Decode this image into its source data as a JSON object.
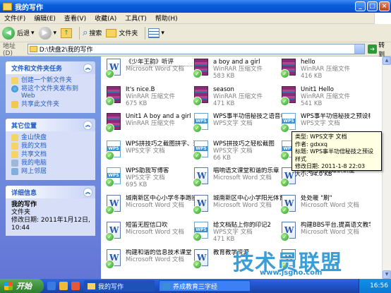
{
  "window": {
    "title": "我的写作"
  },
  "menu": [
    "文件(F)",
    "编辑(E)",
    "查看(V)",
    "收藏(A)",
    "工具(T)",
    "帮助(H)"
  ],
  "toolbar": {
    "back": "后退",
    "search": "搜索",
    "folders": "文件夹"
  },
  "address": {
    "label": "地址(D)",
    "value": "D:\\快盘2\\我的写作",
    "go": "转到"
  },
  "tasks": {
    "title": "文件和文件夹任务",
    "items": [
      "创建一个新文件夹",
      "将这个文件夹发布到 Web",
      "共享此文件夹"
    ]
  },
  "places": {
    "title": "其它位置",
    "items": [
      "金山快盘",
      "我的文档",
      "共享文档",
      "我的电脑",
      "网上邻居"
    ]
  },
  "details": {
    "title": "详细信息",
    "name": "我的写作",
    "type": "文件夹",
    "modified": "修改日期: 2011年1月12日, 10:44"
  },
  "files": [
    {
      "name": "《少年王韵》听评",
      "type": "Microsoft Word 文档",
      "size": "",
      "kind": "word"
    },
    {
      "name": "a boy and a girl",
      "type": "WinRAR 压缩文件",
      "size": "583 KB",
      "kind": "rar"
    },
    {
      "name": "hello",
      "type": "WinRAR 压缩文件",
      "size": "416 KB",
      "kind": "rar"
    },
    {
      "name": "It's nice.B",
      "type": "WinRAR 压缩文件",
      "size": "675 KB",
      "kind": "rar"
    },
    {
      "name": "season",
      "type": "WinRAR 压缩文件",
      "size": "471 KB",
      "kind": "rar"
    },
    {
      "name": "Unit1 Hello",
      "type": "WinRAR 压缩文件",
      "size": "541 KB",
      "kind": "rar"
    },
    {
      "name": "Unit1 A boy and a girl",
      "type": "WinRAR 压缩文件",
      "size": "",
      "kind": "rar"
    },
    {
      "name": "WPS事半功倍秘技之语音校对",
      "type": "WPS文字 文档",
      "size": "",
      "kind": "wps"
    },
    {
      "name": "WPS事半功倍秘技之预设样式",
      "type": "WPS文字 文档",
      "size": "",
      "kind": "wps"
    },
    {
      "name": "WPS拼技巧之截图拼字、速学",
      "type": "WPS文字 文档",
      "size": "",
      "kind": "wps"
    },
    {
      "name": "WPS拼技巧之轻松截图",
      "type": "WPS文字 文档",
      "size": "66 KB",
      "kind": "wps"
    },
    {
      "name": "",
      "type": "",
      "size": "",
      "kind": "wps"
    },
    {
      "name": "WPS助我写博客",
      "type": "WPS文字 文档",
      "size": "695 KB",
      "kind": "wps"
    },
    {
      "name": "唱响语文课堂和谐的乐章",
      "type": "Microsoft Word 文档",
      "size": "",
      "kind": "word"
    },
    {
      "name": "学学行消防知识讲座",
      "type": "",
      "size": "",
      "kind": "word"
    },
    {
      "name": "城南新区中心小学冬季跑操活动正式启动",
      "type": "Microsoft Word 文档",
      "size": "",
      "kind": "word"
    },
    {
      "name": "城南新区中心小学阳光体育活动加火如荼",
      "type": "Microsoft Word 文档",
      "size": "",
      "kind": "word"
    },
    {
      "name": "处处暖 \"刷\"",
      "type": "Microsoft Word 文档",
      "size": "",
      "kind": "word"
    },
    {
      "name": "短笛无腔信口吹",
      "type": "Microsoft Word 文档",
      "size": "",
      "kind": "word"
    },
    {
      "name": "给文档贴上你的印记2",
      "type": "WPS文字 文档",
      "size": "471 KB",
      "kind": "wps"
    },
    {
      "name": "构建BBS平台,提高语文教学效能",
      "type": "Microsoft Word 文档",
      "size": "",
      "kind": "word"
    },
    {
      "name": "构建和谐的信息技术课堂",
      "type": "Microsoft Word 文档",
      "size": "",
      "kind": "word"
    },
    {
      "name": "教育教学资源",
      "type": "",
      "size": "",
      "kind": "word"
    },
    {
      "name": "",
      "type": "",
      "size": "",
      "kind": "word"
    }
  ],
  "tooltip": {
    "type": "类型: WPS文字 文档",
    "author": "作者: gdxxq",
    "title": "标题: WPS事半功倍秘技之预设样式",
    "modified": "修改日期: 2011-1-8 22:03",
    "size": "大小: 94.0 KB"
  },
  "taskbar": {
    "start": "开始",
    "buttons": [
      "我的写作",
      "养成教育三字经"
    ],
    "clock": "16:56"
  },
  "watermark": {
    "text": "技术员联盟",
    "url": "www.jsgho.com"
  }
}
